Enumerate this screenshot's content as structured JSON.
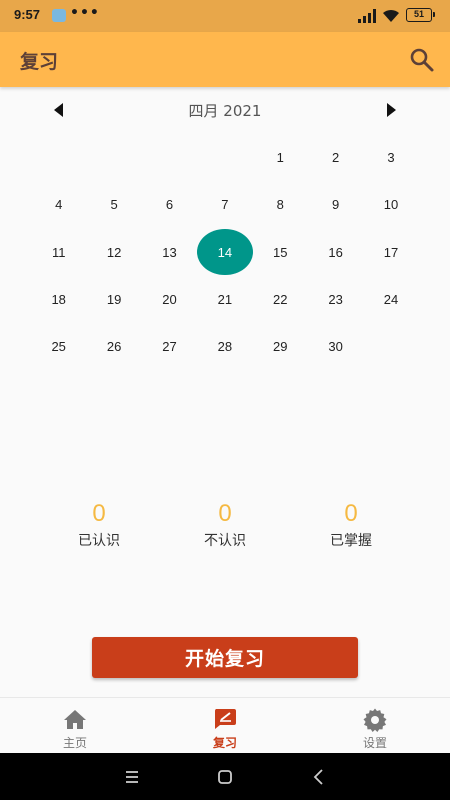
{
  "status_bar": {
    "time": "9:57",
    "dots": "•••",
    "battery": "51"
  },
  "app_bar": {
    "title": "复习",
    "search_icon": "search-icon"
  },
  "calendar": {
    "title": "四月 2021",
    "prev_icon": "chevron-left-icon",
    "next_icon": "chevron-right-icon",
    "leading_blanks": 4,
    "days": [
      "1",
      "2",
      "3",
      "4",
      "5",
      "6",
      "7",
      "8",
      "9",
      "10",
      "11",
      "12",
      "13",
      "14",
      "15",
      "16",
      "17",
      "18",
      "19",
      "20",
      "21",
      "22",
      "23",
      "24",
      "25",
      "26",
      "27",
      "28",
      "29",
      "30"
    ],
    "selected_day": "14",
    "selected_color": "#00968a"
  },
  "stats": [
    {
      "value": "0",
      "label": "已认识"
    },
    {
      "value": "0",
      "label": "不认识"
    },
    {
      "value": "0",
      "label": "已掌握"
    }
  ],
  "start_button": {
    "label": "开始复习",
    "color": "#c93e1a"
  },
  "bottom_nav": [
    {
      "label": "主页",
      "icon": "home-icon",
      "active": false
    },
    {
      "label": "复习",
      "icon": "review-icon",
      "active": true
    },
    {
      "label": "设置",
      "icon": "gear-icon",
      "active": false
    }
  ],
  "colors": {
    "app_bar": "#ffb74d",
    "status_bar": "#e8a74a",
    "stat_value": "#f5b942",
    "accent": "#c93e1a"
  }
}
